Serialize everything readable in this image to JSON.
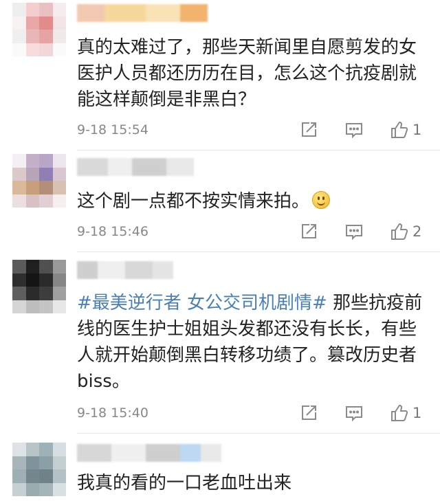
{
  "comments": [
    {
      "lines": [
        "真的太难过了，那些天新闻里自愿剪发的女",
        "医护人员都还历历在目，怎么这个抗疫剧就",
        "能这样颠倒是非黑白？"
      ],
      "time": "9-18 15:54",
      "likes": "1"
    },
    {
      "lines": [
        "这个剧一点都不按实情来拍。"
      ],
      "emoji": "smile-emoji",
      "time": "9-18 15:46",
      "likes": "2"
    },
    {
      "tag": "#最美逆行者 女公交司机剧情#",
      "lines": [
        " 那些抗疫前",
        "线的医生护士姐姐头发都还没有长长，有些",
        "人就开始颠倒黑白转移功绩了。篡改历史者",
        "biss。"
      ],
      "time": "9-18 15:40",
      "likes": "1"
    },
    {
      "lines": [
        "我真的看的一口老血吐出来"
      ]
    }
  ],
  "icons": {
    "share": "share-icon",
    "comment": "comment-icon",
    "like": "thumbs-up-icon"
  },
  "colors": {
    "tag": "#4a7fb5",
    "meta_text": "#888888",
    "divider": "#e6e6e6"
  }
}
